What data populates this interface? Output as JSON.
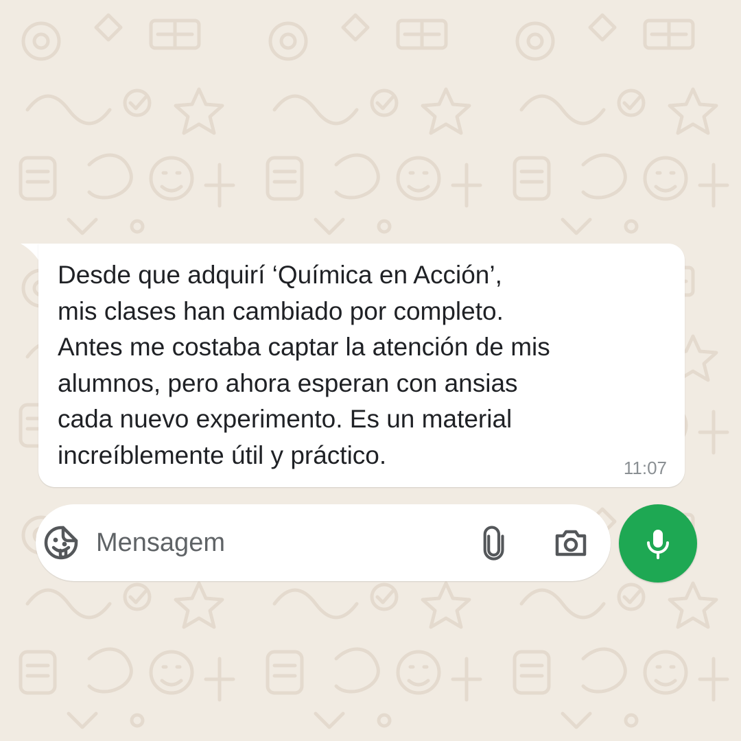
{
  "chat": {
    "message": {
      "text": "Desde que adquirí ‘Química en Acción’,\nmis clases han cambiado por completo.\nAntes me costaba captar la atención de mis\nalumnos, pero ahora esperan con ansias\ncada nuevo experimento. Es un material\nincreíblemente útil y práctico.",
      "time": "11:07"
    }
  },
  "composer": {
    "placeholder": "Mensagem",
    "icons": {
      "sticker": "sticker-smiley-icon",
      "attach": "paperclip-icon",
      "camera": "camera-icon",
      "send": "microphone-icon"
    }
  },
  "colors": {
    "wallpaper": "#f1ebe2",
    "wallpaper_doodle": "#e6ddd1",
    "bubble": "#ffffff",
    "text": "#1f2125",
    "timestamp": "#8a8f93",
    "icon": "#54575a",
    "accent_green": "#1ea853"
  }
}
